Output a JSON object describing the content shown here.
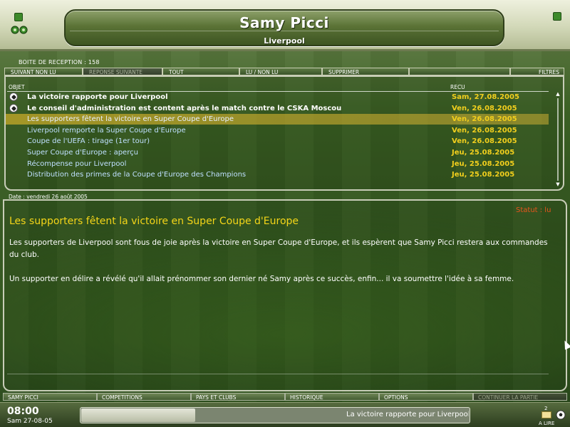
{
  "header": {
    "manager_name": "Samy Picci",
    "club_name": "Liverpool"
  },
  "inbox": {
    "label": "BOITE DE RECEPTION : 158",
    "toolbar": [
      {
        "label": "SUIVANT NON LU",
        "enabled": true
      },
      {
        "label": "REPONSE SUIVANTE",
        "enabled": false
      },
      {
        "label": "TOUT",
        "enabled": true
      },
      {
        "label": "LU / NON LU",
        "enabled": true
      },
      {
        "label": "SUPPRIMER",
        "enabled": true
      },
      {
        "label": "",
        "enabled": true
      },
      {
        "label": "FILTRES",
        "enabled": true
      }
    ],
    "columns": {
      "subject": "OBJET",
      "received": "RECU"
    },
    "messages": [
      {
        "subject": "La victoire rapporte pour Liverpool",
        "date": "Sam, 27.08.2005",
        "unread": true,
        "selected": false
      },
      {
        "subject": "Le conseil d'administration est content après le match contre le CSKA Moscou",
        "date": "Ven, 26.08.2005",
        "unread": true,
        "selected": false
      },
      {
        "subject": "Les supporters fêtent la victoire en Super Coupe d'Europe",
        "date": "Ven, 26.08.2005",
        "unread": false,
        "selected": true
      },
      {
        "subject": "Liverpool remporte la Super Coupe d'Europe",
        "date": "Ven, 26.08.2005",
        "unread": false,
        "selected": false
      },
      {
        "subject": "Coupe de l'UEFA : tirage (1er tour)",
        "date": "Ven, 26.08.2005",
        "unread": false,
        "selected": false
      },
      {
        "subject": "Super Coupe d'Europe : aperçu",
        "date": "Jeu, 25.08.2005",
        "unread": false,
        "selected": false
      },
      {
        "subject": "Récompense pour Liverpool",
        "date": "Jeu, 25.08.2005",
        "unread": false,
        "selected": false
      },
      {
        "subject": "Distribution des primes de la Coupe d'Europe des Champions",
        "date": "Jeu, 25.08.2005",
        "unread": false,
        "selected": false
      }
    ]
  },
  "detail": {
    "date_label": "Date : vendredi 26 août 2005",
    "status": "Statut : lu",
    "title": "Les supporters fêtent la victoire en Super Coupe d'Europe",
    "paragraphs": [
      "Les supporters de Liverpool sont fous de joie après la victoire en Super Coupe d'Europe, et ils espèrent que Samy Picci restera aux commandes du club.",
      "Un supporter en délire a révélé qu'il allait prénommer son dernier né Samy après ce succès, enfin... il va soumettre l'idée à sa femme."
    ]
  },
  "bottom_nav": [
    {
      "label": "SAMY PICCI",
      "enabled": true
    },
    {
      "label": "COMPETITIONS",
      "enabled": true
    },
    {
      "label": "PAYS ET CLUBS",
      "enabled": true
    },
    {
      "label": "HISTORIQUE",
      "enabled": true
    },
    {
      "label": "OPTIONS",
      "enabled": true
    },
    {
      "label": "CONTINUER LA PARTIE",
      "enabled": false
    }
  ],
  "status_bar": {
    "time": "08:00",
    "date": "Sam 27-08-05",
    "ticker": "La victoire rapporte pour Liverpool",
    "mail_count": "2",
    "mail_label": "A LIRE"
  },
  "colors": {
    "accent_date": "#f2cf1d",
    "title": "#f4d518",
    "status": "#e7541c",
    "read_link": "#bfe0ff"
  }
}
